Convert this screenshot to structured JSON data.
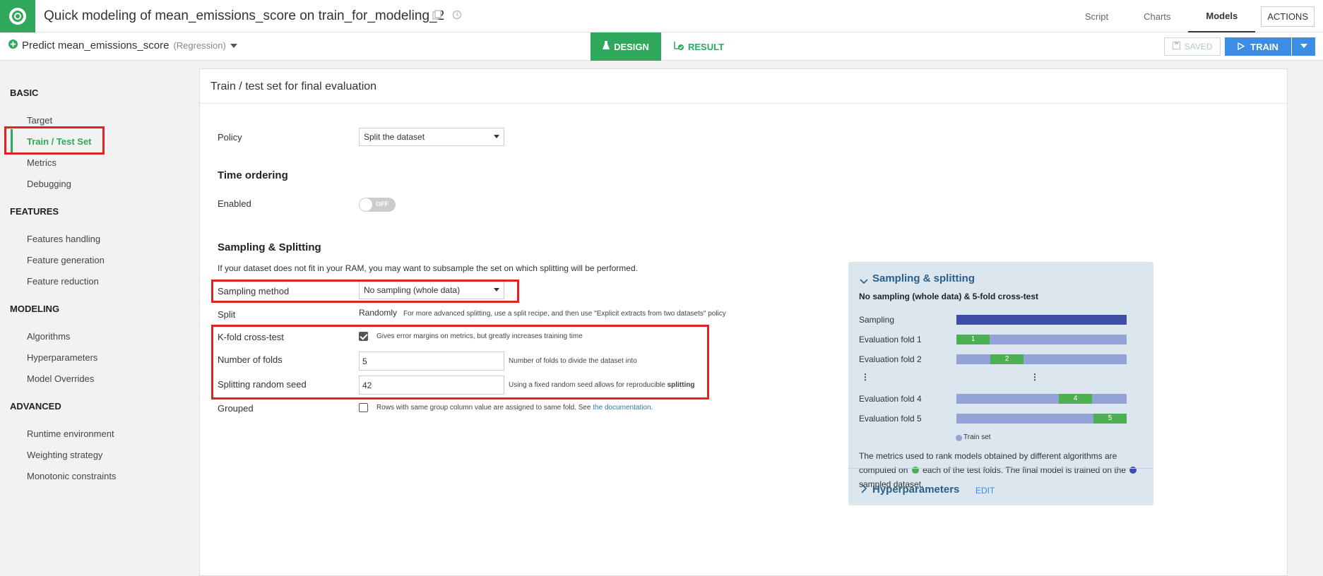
{
  "header": {
    "title": "Quick modeling of mean_emissions_score on train_for_modeling_2",
    "nav": [
      "Script",
      "Charts",
      "Models"
    ],
    "active_nav": "Models",
    "actions_label": "ACTIONS"
  },
  "subbar": {
    "predict_label": "Predict mean_emissions_score",
    "predict_type": "(Regression)",
    "design_tab": "DESIGN",
    "result_tab": "RESULT",
    "saved_label": "SAVED",
    "train_label": "TRAIN"
  },
  "sidebar": {
    "sections": [
      {
        "title": "BASIC",
        "items": [
          "Target",
          "Train / Test Set",
          "Metrics",
          "Debugging"
        ]
      },
      {
        "title": "FEATURES",
        "items": [
          "Features handling",
          "Feature generation",
          "Feature reduction"
        ]
      },
      {
        "title": "MODELING",
        "items": [
          "Algorithms",
          "Hyperparameters",
          "Model Overrides"
        ]
      },
      {
        "title": "ADVANCED",
        "items": [
          "Runtime environment",
          "Weighting strategy",
          "Monotonic constraints"
        ]
      }
    ],
    "active_item": "Train / Test Set"
  },
  "panel": {
    "title": "Train / test set for final evaluation",
    "policy_label": "Policy",
    "policy_value": "Split the dataset",
    "time_ordering_title": "Time ordering",
    "enabled_label": "Enabled",
    "enabled_toggle": "OFF",
    "sampling_title": "Sampling & Splitting",
    "sampling_desc": "If your dataset does not fit in your RAM, you may want to subsample the set on which splitting will be performed.",
    "sampling_method_label": "Sampling method",
    "sampling_method_value": "No sampling (whole data)",
    "split_label": "Split",
    "split_value": "Randomly",
    "split_help": "For more advanced splitting, use a split recipe, and then use \"Explicit extracts from two datasets\" policy",
    "kfold_label": "K-fold cross-test",
    "kfold_help": "Gives error margins on metrics, but greatly increases training time",
    "folds_label": "Number of folds",
    "folds_value": "5",
    "folds_help": "Number of folds to divide the dataset into",
    "seed_label": "Splitting random seed",
    "seed_value": "42",
    "seed_help": "Using a fixed random seed allows for reproducible",
    "seed_help_bold": "splitting",
    "grouped_label": "Grouped",
    "grouped_help": "Rows with same group column value are assigned to same fold. See",
    "grouped_link": "the documentation",
    "grouped_end": "."
  },
  "sampling_box": {
    "title": "Sampling & splitting",
    "subtitle": "No sampling (whole data) & 5-fold cross-test",
    "sampling_label": "Sampling",
    "folds": [
      {
        "label": "Evaluation fold 1",
        "index": "1"
      },
      {
        "label": "Evaluation fold 2",
        "index": "2"
      },
      {
        "label": "Evaluation fold 4",
        "index": "4"
      },
      {
        "label": "Evaluation fold 5",
        "index": "5"
      }
    ],
    "legend_train": "Train set",
    "text_1": "The metrics used to rank models obtained by different algorithms are computed on",
    "text_2": "each of the test folds. The final model is trained on the",
    "text_3": "sampled dataset.",
    "hyper_title": "Hyperparameters",
    "edit_label": "EDIT"
  },
  "colors": {
    "brand_green": "#2fa85b",
    "train_blue": "#3b8de5",
    "fold_green": "#4caf50",
    "train_set": "#93a3d8",
    "full_sample": "#3c4ea8",
    "highlight_red": "#e02424"
  }
}
